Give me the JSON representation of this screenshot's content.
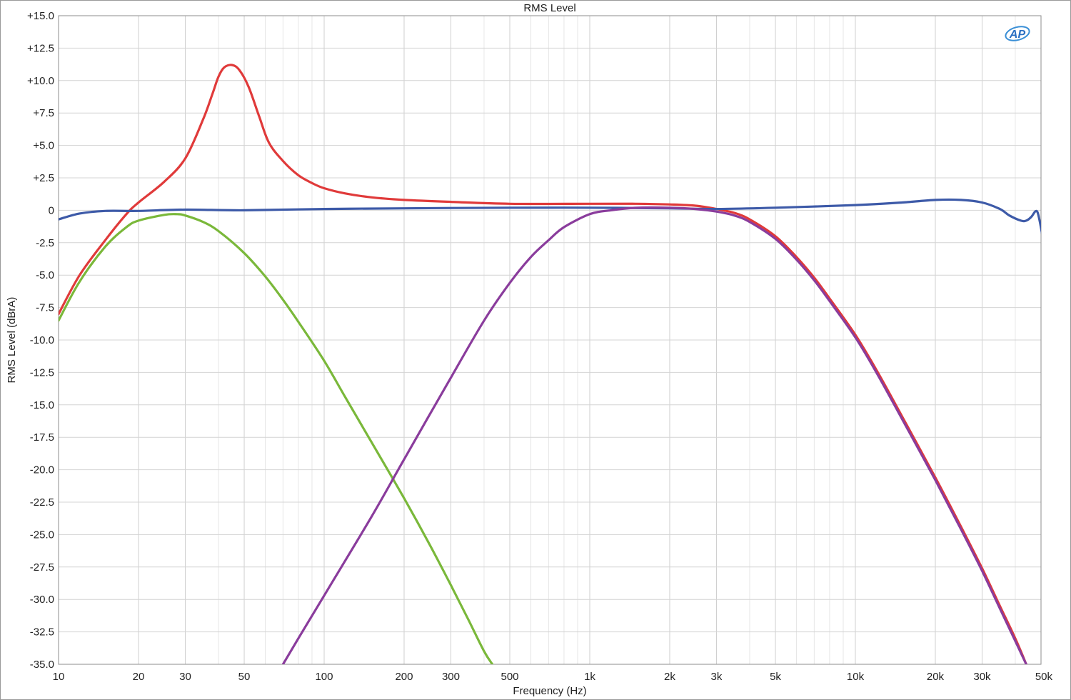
{
  "chart_data": {
    "type": "line",
    "title": "RMS Level",
    "xlabel": "Frequency (Hz)",
    "ylabel": "RMS Level (dBrA)",
    "x_scale": "log",
    "xlim": [
      10,
      50000
    ],
    "ylim": [
      -35,
      15
    ],
    "grid": true,
    "logo_text": "AP",
    "x_ticks": [
      {
        "value": 10,
        "label": "10"
      },
      {
        "value": 20,
        "label": "20"
      },
      {
        "value": 30,
        "label": "30"
      },
      {
        "value": 50,
        "label": "50"
      },
      {
        "value": 100,
        "label": "100"
      },
      {
        "value": 200,
        "label": "200"
      },
      {
        "value": 300,
        "label": "300"
      },
      {
        "value": 500,
        "label": "500"
      },
      {
        "value": 1000,
        "label": "1k"
      },
      {
        "value": 2000,
        "label": "2k"
      },
      {
        "value": 3000,
        "label": "3k"
      },
      {
        "value": 5000,
        "label": "5k"
      },
      {
        "value": 10000,
        "label": "10k"
      },
      {
        "value": 20000,
        "label": "20k"
      },
      {
        "value": 30000,
        "label": "30k"
      },
      {
        "value": 50000,
        "label": "50k"
      }
    ],
    "y_ticks": [
      {
        "value": 15,
        "label": "+15.0"
      },
      {
        "value": 12.5,
        "label": "+12.5"
      },
      {
        "value": 10,
        "label": "+10.0"
      },
      {
        "value": 7.5,
        "label": "+7.5"
      },
      {
        "value": 5,
        "label": "+5.0"
      },
      {
        "value": 2.5,
        "label": "+2.5"
      },
      {
        "value": 0,
        "label": "0"
      },
      {
        "value": -2.5,
        "label": "-2.5"
      },
      {
        "value": -5,
        "label": "-5.0"
      },
      {
        "value": -7.5,
        "label": "-7.5"
      },
      {
        "value": -10,
        "label": "-10.0"
      },
      {
        "value": -12.5,
        "label": "-12.5"
      },
      {
        "value": -15,
        "label": "-15.0"
      },
      {
        "value": -17.5,
        "label": "-17.5"
      },
      {
        "value": -20,
        "label": "-20.0"
      },
      {
        "value": -22.5,
        "label": "-22.5"
      },
      {
        "value": -25,
        "label": "-25.0"
      },
      {
        "value": -27.5,
        "label": "-27.5"
      },
      {
        "value": -30,
        "label": "-30.0"
      },
      {
        "value": -32.5,
        "label": "-32.5"
      },
      {
        "value": -35,
        "label": "-35.0"
      }
    ],
    "series": [
      {
        "color": "#e03a3a",
        "points": [
          [
            10,
            -8
          ],
          [
            12,
            -5
          ],
          [
            15,
            -2.3
          ],
          [
            18,
            -0.3
          ],
          [
            20,
            0.6
          ],
          [
            25,
            2.2
          ],
          [
            30,
            4
          ],
          [
            35,
            7
          ],
          [
            38,
            9
          ],
          [
            40,
            10.3
          ],
          [
            42,
            11
          ],
          [
            45,
            11.2
          ],
          [
            48,
            10.8
          ],
          [
            52,
            9.5
          ],
          [
            57,
            7.2
          ],
          [
            62,
            5.2
          ],
          [
            70,
            3.8
          ],
          [
            80,
            2.7
          ],
          [
            90,
            2.1
          ],
          [
            100,
            1.7
          ],
          [
            120,
            1.3
          ],
          [
            150,
            1.0
          ],
          [
            200,
            0.8
          ],
          [
            300,
            0.65
          ],
          [
            500,
            0.5
          ],
          [
            1000,
            0.5
          ],
          [
            1500,
            0.5
          ],
          [
            2000,
            0.45
          ],
          [
            2500,
            0.35
          ],
          [
            3000,
            0.1
          ],
          [
            3500,
            -0.2
          ],
          [
            4000,
            -0.7
          ],
          [
            5000,
            -2
          ],
          [
            6000,
            -3.6
          ],
          [
            7000,
            -5.2
          ],
          [
            8000,
            -6.8
          ],
          [
            10000,
            -9.6
          ],
          [
            12000,
            -12.3
          ],
          [
            15000,
            -15.9
          ],
          [
            20000,
            -20.6
          ],
          [
            25000,
            -24.4
          ],
          [
            30000,
            -27.6
          ],
          [
            35000,
            -30.5
          ],
          [
            40000,
            -33
          ],
          [
            44000,
            -35
          ]
        ]
      },
      {
        "color": "#3d5aa8",
        "points": [
          [
            10,
            -0.7
          ],
          [
            12,
            -0.25
          ],
          [
            15,
            -0.05
          ],
          [
            20,
            -0.05
          ],
          [
            30,
            0.05
          ],
          [
            50,
            0
          ],
          [
            100,
            0.1
          ],
          [
            200,
            0.15
          ],
          [
            500,
            0.2
          ],
          [
            1000,
            0.2
          ],
          [
            2000,
            0.15
          ],
          [
            3000,
            0.1
          ],
          [
            5000,
            0.2
          ],
          [
            10000,
            0.4
          ],
          [
            15000,
            0.6
          ],
          [
            20000,
            0.8
          ],
          [
            25000,
            0.8
          ],
          [
            30000,
            0.6
          ],
          [
            35000,
            0.1
          ],
          [
            38000,
            -0.4
          ],
          [
            42000,
            -0.8
          ],
          [
            44000,
            -0.8
          ],
          [
            46000,
            -0.5
          ],
          [
            47500,
            -0.1
          ],
          [
            48500,
            -0.15
          ],
          [
            49500,
            -0.9
          ],
          [
            51000,
            -2.3
          ],
          [
            53000,
            -3.9
          ],
          [
            55000,
            -5.2
          ]
        ]
      },
      {
        "color": "#7ab83a",
        "points": [
          [
            10,
            -8.5
          ],
          [
            12,
            -5.5
          ],
          [
            15,
            -2.8
          ],
          [
            18,
            -1.3
          ],
          [
            20,
            -0.8
          ],
          [
            25,
            -0.35
          ],
          [
            28,
            -0.3
          ],
          [
            30,
            -0.4
          ],
          [
            35,
            -0.9
          ],
          [
            40,
            -1.6
          ],
          [
            50,
            -3.3
          ],
          [
            60,
            -5.1
          ],
          [
            70,
            -6.9
          ],
          [
            80,
            -8.6
          ],
          [
            100,
            -11.6
          ],
          [
            120,
            -14.4
          ],
          [
            150,
            -17.8
          ],
          [
            200,
            -22.2
          ],
          [
            250,
            -25.8
          ],
          [
            300,
            -28.9
          ],
          [
            350,
            -31.6
          ],
          [
            400,
            -34
          ],
          [
            430,
            -35
          ]
        ]
      },
      {
        "color": "#8a3c9c",
        "points": [
          [
            70,
            -35
          ],
          [
            80,
            -33
          ],
          [
            100,
            -29.7
          ],
          [
            150,
            -23.7
          ],
          [
            200,
            -19.2
          ],
          [
            300,
            -12.9
          ],
          [
            400,
            -8.5
          ],
          [
            500,
            -5.6
          ],
          [
            600,
            -3.6
          ],
          [
            700,
            -2.3
          ],
          [
            800,
            -1.3
          ],
          [
            1000,
            -0.3
          ],
          [
            1200,
            0
          ],
          [
            1500,
            0.2
          ],
          [
            2000,
            0.2
          ],
          [
            2500,
            0.1
          ],
          [
            3000,
            -0.1
          ],
          [
            3500,
            -0.4
          ],
          [
            4000,
            -0.9
          ],
          [
            5000,
            -2.2
          ],
          [
            6000,
            -3.8
          ],
          [
            7000,
            -5.4
          ],
          [
            8000,
            -7
          ],
          [
            10000,
            -9.8
          ],
          [
            12000,
            -12.5
          ],
          [
            15000,
            -16.1
          ],
          [
            20000,
            -20.8
          ],
          [
            25000,
            -24.6
          ],
          [
            30000,
            -27.8
          ],
          [
            35000,
            -30.7
          ],
          [
            40000,
            -33.2
          ],
          [
            44000,
            -35
          ]
        ]
      }
    ]
  }
}
